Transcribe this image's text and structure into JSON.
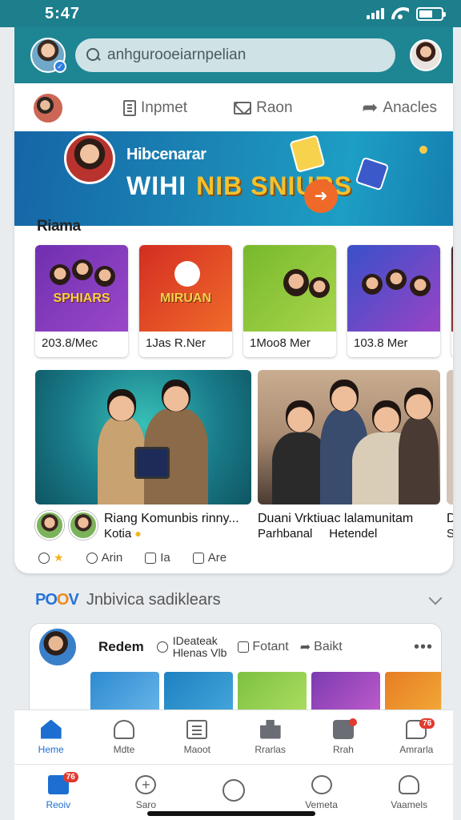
{
  "status": {
    "time": "5:47"
  },
  "header": {
    "search_placeholder": "anhgurooeiarnpelian"
  },
  "actions": [
    {
      "label": "Inpmet",
      "icon": "document-icon"
    },
    {
      "label": "Raon",
      "icon": "mail-icon"
    },
    {
      "label": "Anacles",
      "icon": "share-icon"
    }
  ],
  "banner": {
    "subtitle": "Hibcenarar",
    "title_left": "WIHI",
    "title_right": "NIB SNIURS"
  },
  "section": {
    "title": "Riama"
  },
  "games": [
    {
      "label": "203.8/Mec",
      "art": "SPHIARS"
    },
    {
      "label": "1Jas R.Ner",
      "art": "MIRUAN"
    },
    {
      "label": "1Moo8 Mer",
      "art": ""
    },
    {
      "label": "103.8 Mer",
      "art": ""
    },
    {
      "label": "D",
      "art": ""
    }
  ],
  "features": [
    {
      "title": "Riang Komunbis rinny...",
      "subtitle": "Kotia",
      "actions": [
        "",
        "Arin",
        "Ia",
        "Are"
      ]
    },
    {
      "title": "Duani Vrktiuac",
      "title2": "lalamunitam",
      "subtitle": "Parhbanal",
      "subtitle2": "Hetendel"
    },
    {
      "title": "D",
      "subtitle": "S"
    }
  ],
  "discover": {
    "logo": [
      "PO",
      "O",
      "V"
    ],
    "title": "Jnbivica sadiklears",
    "post": {
      "name": "Redem",
      "tag_line1": "IDeateak",
      "tag_line2": "Hlenas Vlb",
      "action1": "Fotant",
      "action2": "Baikt",
      "more": "•••"
    }
  },
  "nav_primary": [
    {
      "label": "Heme",
      "icon": "home-icon",
      "active": true
    },
    {
      "label": "Mdte",
      "icon": "user-icon"
    },
    {
      "label": "Maoot",
      "icon": "list-icon"
    },
    {
      "label": "Rrarlas",
      "icon": "bag-icon"
    },
    {
      "label": "Rrah",
      "icon": "camera-icon",
      "dot": true
    },
    {
      "label": "Amrarla",
      "icon": "chat-icon",
      "badge": "76"
    }
  ],
  "nav_secondary": [
    {
      "label": "Reoiv",
      "icon": "pin-icon",
      "active": true,
      "badge": "76"
    },
    {
      "label": "Saro",
      "icon": "plus-icon"
    },
    {
      "label": "",
      "icon": "game-icon"
    },
    {
      "label": "Vemeta",
      "icon": "compass-icon"
    },
    {
      "label": "Vaamels",
      "icon": "person-icon"
    }
  ],
  "colors": {
    "header": "#1e8593",
    "status_bar": "#1d7e8c",
    "accent": "#1c6fd1",
    "badge": "#e13a2e"
  }
}
